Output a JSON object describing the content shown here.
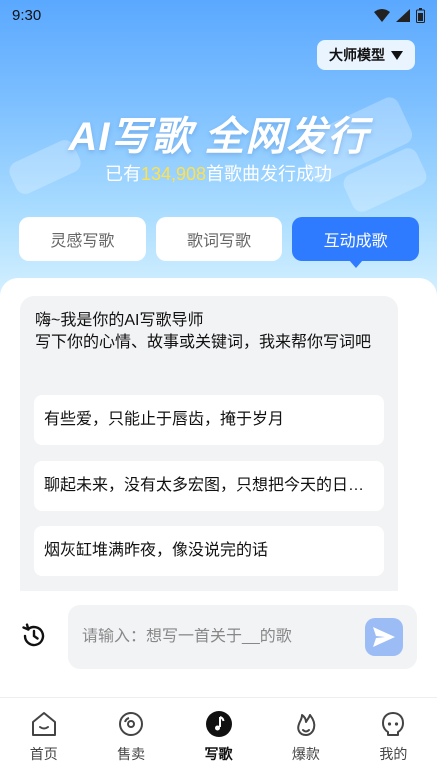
{
  "status_bar": {
    "time": "9:30"
  },
  "header": {
    "model_selector": {
      "label": "大师模型",
      "icon": "caret-down-icon"
    },
    "title": "AI写歌 全网发行",
    "subtitle_prefix": "已有",
    "subtitle_count": "134,908",
    "subtitle_suffix": "首歌曲发行成功"
  },
  "tabs": [
    {
      "label": "灵感写歌",
      "active": false
    },
    {
      "label": "歌词写歌",
      "active": false
    },
    {
      "label": "互动成歌",
      "active": true
    }
  ],
  "chat": {
    "greeting_line1": "嗨~我是你的AI写歌导师",
    "greeting_line2": "写下你的心情、故事或关键词，我来帮你写词吧",
    "suggestions": [
      "有些爱，只能止于唇齿，掩于岁月",
      "聊起未来，没有太多宏图，只想把今天的日子过好",
      "烟灰缸堆满昨夜，像没说完的话"
    ]
  },
  "composer": {
    "placeholder": "请输入：想写一首关于__的歌",
    "value": ""
  },
  "nav": [
    {
      "label": "首页",
      "icon": "home-icon",
      "active": false
    },
    {
      "label": "售卖",
      "icon": "disc-icon",
      "active": false
    },
    {
      "label": "写歌",
      "icon": "music-note-icon",
      "active": true
    },
    {
      "label": "爆款",
      "icon": "flame-icon",
      "active": false
    },
    {
      "label": "我的",
      "icon": "profile-icon",
      "active": false
    }
  ],
  "colors": {
    "accent": "#2f7bff",
    "highlight": "#ffe14b",
    "send_button": "#9cbcf5"
  }
}
